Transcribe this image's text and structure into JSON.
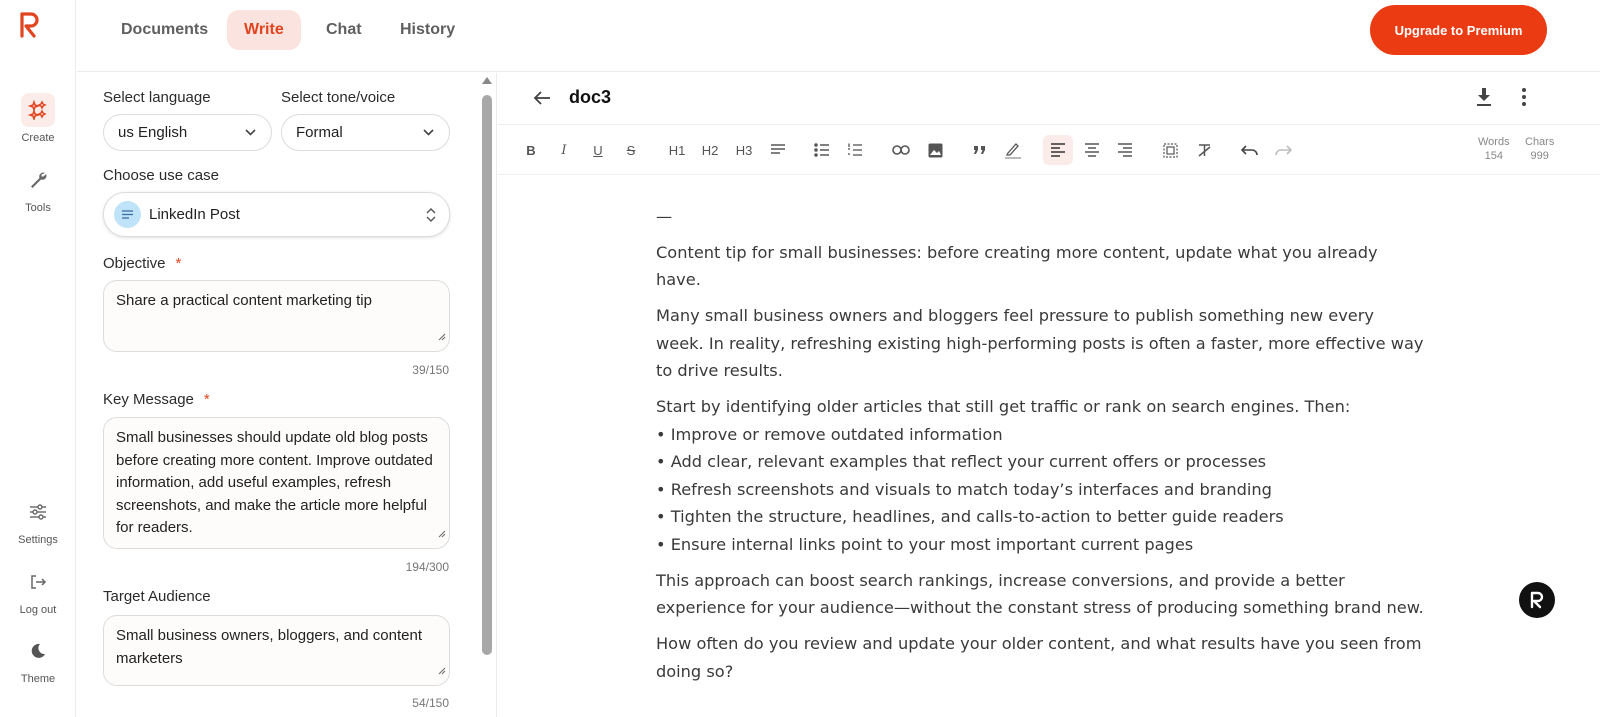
{
  "app": {
    "brand_color": "#e0451f",
    "accent_bg": "#fbe3df"
  },
  "sidebar": {
    "items": [
      {
        "label": "Create",
        "icon": "sparkle-icon",
        "active": true
      },
      {
        "label": "Tools",
        "icon": "wrench-icon",
        "active": false
      },
      {
        "label": "Settings",
        "icon": "sliders-icon",
        "active": false
      },
      {
        "label": "Log out",
        "icon": "logout-icon",
        "active": false
      },
      {
        "label": "Theme",
        "icon": "moon-icon",
        "active": false
      }
    ]
  },
  "header": {
    "tabs": [
      {
        "label": "Documents",
        "active": false
      },
      {
        "label": "Write",
        "active": true
      },
      {
        "label": "Chat",
        "active": false
      },
      {
        "label": "History",
        "active": false
      }
    ],
    "upgrade_label": "Upgrade to Premium"
  },
  "form": {
    "language": {
      "label": "Select language",
      "value": "us English"
    },
    "tone": {
      "label": "Select tone/voice",
      "value": "Formal"
    },
    "use_case": {
      "label": "Choose use case",
      "value": "LinkedIn Post"
    },
    "objective": {
      "label": "Objective",
      "required_mark": "*",
      "value": "Share a practical content marketing tip",
      "counter": "39/150"
    },
    "key_message": {
      "label": "Key Message",
      "required_mark": "*",
      "value": "Small businesses should update old blog posts before creating more content. Improve outdated information, add useful examples, refresh screenshots, and make the article more helpful for readers.",
      "counter": "194/300"
    },
    "target_audience": {
      "label": "Target Audience",
      "value": "Small business owners, bloggers, and content marketers",
      "counter": "54/150"
    }
  },
  "editor": {
    "doc_title": "doc3",
    "toolbar": {
      "bold": "B",
      "italic": "I",
      "underline": "U",
      "strike": "S",
      "h1": "H1",
      "h2": "H2",
      "h3": "H3",
      "active_button": "align-left"
    },
    "stats": {
      "words_label": "Words",
      "words_value": "154",
      "chars_label": "Chars",
      "chars_value": "999"
    },
    "content": {
      "separator": "—",
      "p1": "Content tip for small businesses: before creating more content, update what you already have.",
      "p2": "Many small business owners and bloggers feel pressure to publish something new every week. In reality, refreshing existing high-performing posts is often a faster, more effective way to drive results.",
      "p3_intro": "Start by identifying older articles that still get traffic or rank on search engines. Then:",
      "bullets": [
        "• Improve or remove outdated information",
        "• Add clear, relevant examples that reflect your current offers or processes",
        "• Refresh screenshots and visuals to match today’s interfaces and branding",
        "• Tighten the structure, headlines, and calls-to-action to better guide readers",
        "• Ensure internal links point to your most important current pages"
      ],
      "p4": "This approach can boost search rankings, increase conversions, and provide a better experience for your audience—without the constant stress of producing something brand new.",
      "p5": "How often do you review and update your older content, and what results have you seen from doing so?"
    }
  }
}
